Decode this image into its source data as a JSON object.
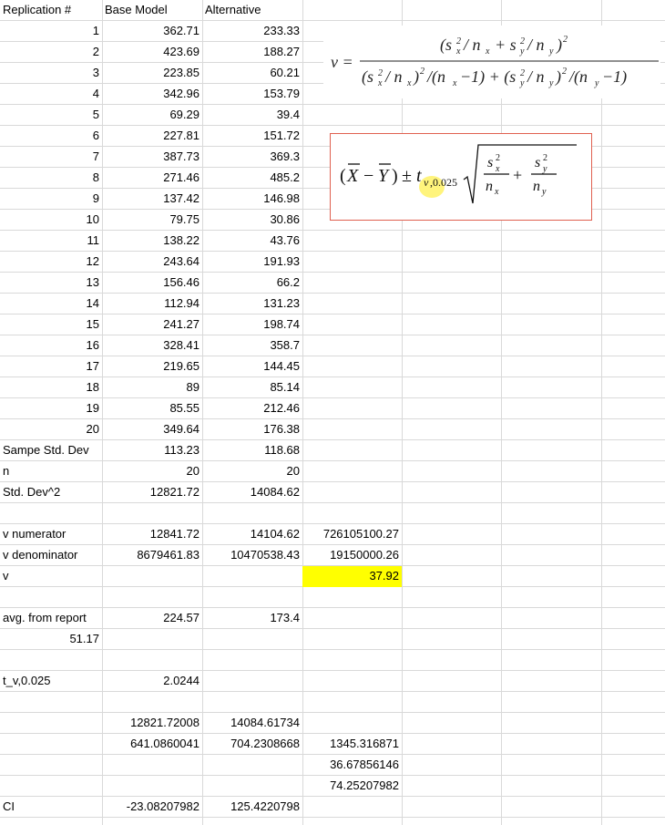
{
  "headers": {
    "col_a": "Replication #",
    "col_b": "Base Model",
    "col_c": "Alternative"
  },
  "rows": [
    {
      "n": "1",
      "base": "362.71",
      "alt": "233.33"
    },
    {
      "n": "2",
      "base": "423.69",
      "alt": "188.27"
    },
    {
      "n": "3",
      "base": "223.85",
      "alt": "60.21"
    },
    {
      "n": "4",
      "base": "342.96",
      "alt": "153.79"
    },
    {
      "n": "5",
      "base": "69.29",
      "alt": "39.4"
    },
    {
      "n": "6",
      "base": "227.81",
      "alt": "151.72"
    },
    {
      "n": "7",
      "base": "387.73",
      "alt": "369.3"
    },
    {
      "n": "8",
      "base": "271.46",
      "alt": "485.2"
    },
    {
      "n": "9",
      "base": "137.42",
      "alt": "146.98"
    },
    {
      "n": "10",
      "base": "79.75",
      "alt": "30.86"
    },
    {
      "n": "11",
      "base": "138.22",
      "alt": "43.76"
    },
    {
      "n": "12",
      "base": "243.64",
      "alt": "191.93"
    },
    {
      "n": "13",
      "base": "156.46",
      "alt": "66.2"
    },
    {
      "n": "14",
      "base": "112.94",
      "alt": "131.23"
    },
    {
      "n": "15",
      "base": "241.27",
      "alt": "198.74"
    },
    {
      "n": "16",
      "base": "328.41",
      "alt": "358.7"
    },
    {
      "n": "17",
      "base": "219.65",
      "alt": "144.45"
    },
    {
      "n": "18",
      "base": "89",
      "alt": "85.14"
    },
    {
      "n": "19",
      "base": "85.55",
      "alt": "212.46"
    },
    {
      "n": "20",
      "base": "349.64",
      "alt": "176.38"
    }
  ],
  "stats": {
    "std_label": "Sampe Std. Dev",
    "std_base": "113.23",
    "std_alt": "118.68",
    "n_label": "n",
    "n_base": "20",
    "n_alt": "20",
    "sq_label": "Std. Dev^2",
    "sq_base": "12821.72",
    "sq_alt": "14084.62"
  },
  "v": {
    "num_label": "v numerator",
    "num_base": "12841.72",
    "num_alt": "14104.62",
    "num_total": "726105100.27",
    "den_label": "v denominator",
    "den_base": "8679461.83",
    "den_alt": "10470538.43",
    "den_total": "19150000.26",
    "v_label": "v",
    "v_value": "37.92"
  },
  "avg": {
    "label": "avg. from report",
    "base": "224.57",
    "alt": "173.4",
    "diff": "51.17"
  },
  "t": {
    "label": "t_v,0.025",
    "value": "2.0244"
  },
  "calc": {
    "row1_base": "12821.72008",
    "row1_alt": "14084.61734",
    "row2_base": "641.0860041",
    "row2_alt": "704.2308668",
    "row2_d": "1345.316871",
    "row3_d": "36.67856146",
    "row4_d": "74.25207982"
  },
  "ci": {
    "label": "CI",
    "low": "-23.08207982",
    "high": "125.4220798"
  },
  "colors": {
    "gridline": "#d9d9d9",
    "highlight": "#ffff00",
    "formula_border": "#e06050"
  }
}
